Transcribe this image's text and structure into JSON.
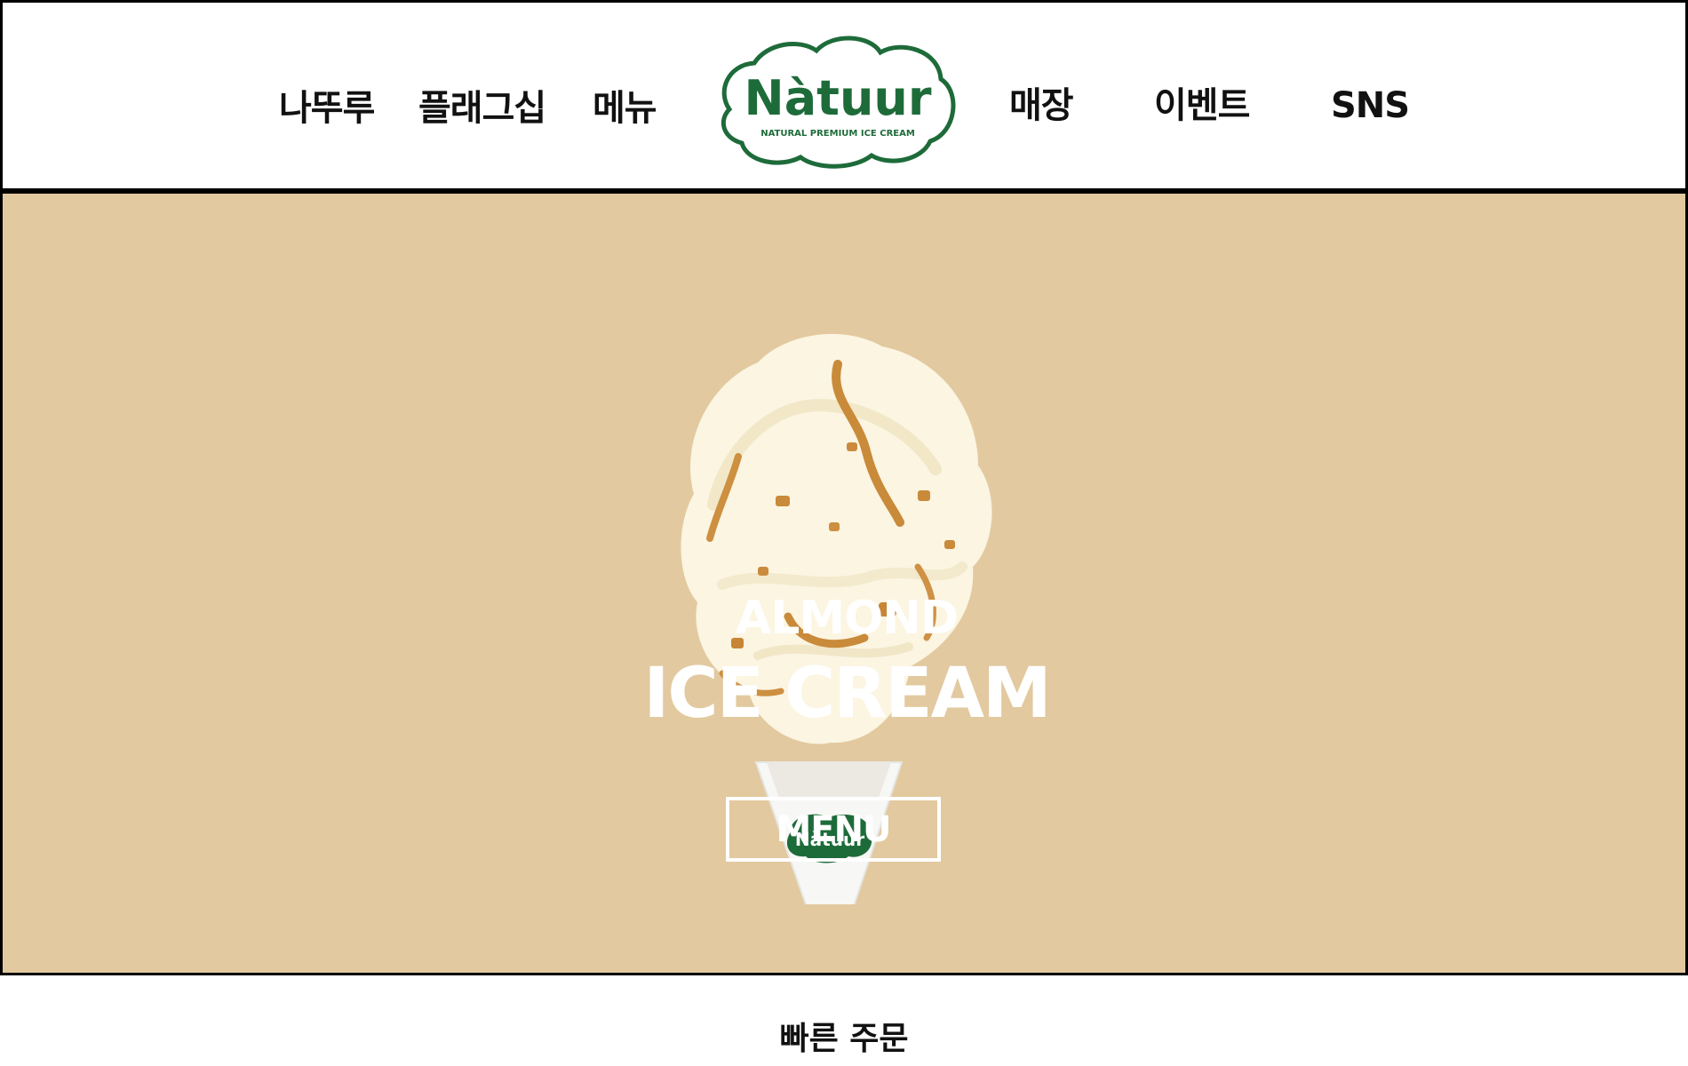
{
  "header": {
    "nav_left": [
      {
        "label": "나뚜루"
      },
      {
        "label": "플래그십"
      },
      {
        "label": "메뉴"
      }
    ],
    "nav_right": [
      {
        "label": "매장"
      },
      {
        "label": "이벤트"
      },
      {
        "label": "SNS"
      }
    ],
    "logo": {
      "brand": "Nàtuur",
      "tagline": "NATURAL PREMIUM ICE CREAM",
      "color": "#1e6b3a"
    }
  },
  "hero": {
    "subtitle": "ALMOND",
    "title": "ICE CREAM",
    "button_label": "MENU",
    "background": "#e2c99f",
    "cone_logo": "Nàtuur"
  },
  "quick_order": {
    "label": "빠른 주문"
  }
}
